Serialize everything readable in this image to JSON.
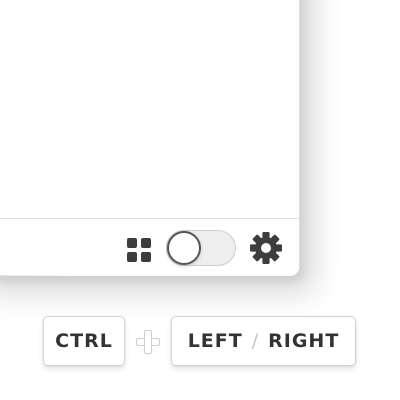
{
  "footer": {
    "grid_icon": "grid-icon",
    "toggle": {
      "state": "off",
      "icon": "toggle-switch"
    },
    "settings_icon": "gear-icon"
  },
  "shortcut": {
    "key1": "CTRL",
    "plus_icon": "plus-icon",
    "key2_left": "LEFT",
    "key2_separator": "/",
    "key2_right": "RIGHT"
  },
  "colors": {
    "icon": "#3d3d3d",
    "key_text": "#333333",
    "separator": "#c4c4c4",
    "border": "#d2d2d2"
  }
}
